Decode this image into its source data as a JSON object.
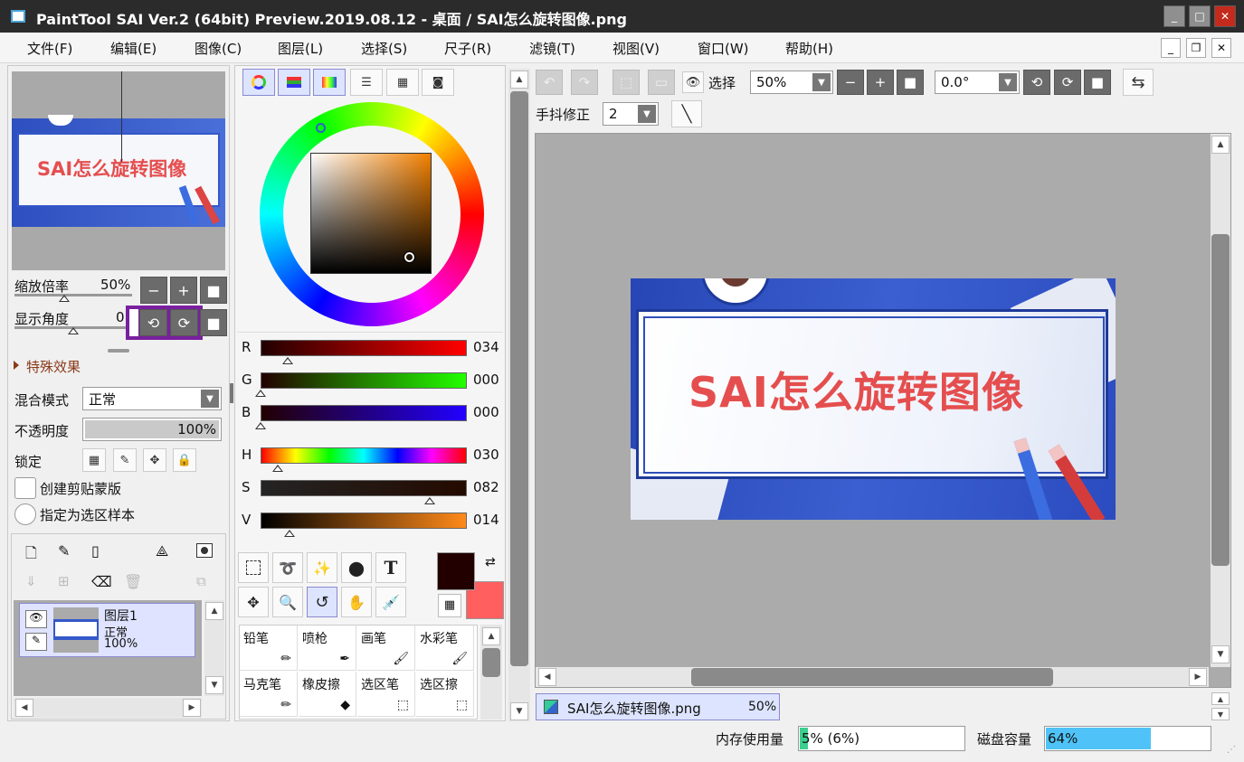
{
  "window": {
    "title": "PaintTool SAI Ver.2 (64bit) Preview.2019.08.12 - 桌面 / SAI怎么旋转图像.png",
    "minimize": "_",
    "maximize": "□",
    "close": "✕"
  },
  "menu": {
    "items": [
      "文件(F)",
      "编辑(E)",
      "图像(C)",
      "图层(L)",
      "选择(S)",
      "尺子(R)",
      "滤镜(T)",
      "视图(V)",
      "窗口(W)",
      "帮助(H)"
    ],
    "doc_min": "_",
    "doc_restore": "❐",
    "doc_close": "✕"
  },
  "navigator": {
    "banner_text": "SAI怎么旋转图像",
    "zoom_label": "缩放倍率",
    "zoom_value": "50%",
    "angle_label": "显示角度",
    "angle_value": "0",
    "zoom_level": 0.5
  },
  "layer_props": {
    "effects_label": "特殊效果",
    "blend_label": "混合模式",
    "blend_value": "正常",
    "opacity_label": "不透明度",
    "opacity_value": "100%",
    "opacity_fraction": 1.0,
    "lock_label": "锁定",
    "clip_label": "创建剪贴蒙版",
    "sample_label": "指定为选区样本"
  },
  "layers": [
    {
      "name": "图层1",
      "mode": "正常",
      "opacity": "100%"
    }
  ],
  "color": {
    "rgb": [
      {
        "label": "R",
        "value": "034",
        "fraction": 0.133
      },
      {
        "label": "G",
        "value": "000",
        "fraction": 0.0
      },
      {
        "label": "B",
        "value": "000",
        "fraction": 0.0
      }
    ],
    "hsv": [
      {
        "label": "H",
        "value": "030",
        "fraction": 0.083
      },
      {
        "label": "S",
        "value": "082",
        "fraction": 0.82
      },
      {
        "label": "V",
        "value": "014",
        "fraction": 0.14
      }
    ],
    "foreground": "#220000",
    "background": "#ff5f5f"
  },
  "tools": {
    "text_tool_label": "T"
  },
  "brushes": [
    "铅笔",
    "喷枪",
    "画笔",
    "水彩笔",
    "马克笔",
    "橡皮擦",
    "选区笔",
    "选区擦"
  ],
  "canvas_toolbar": {
    "select_label": "选择",
    "zoom_value": "50%",
    "angle_value": "0.0°",
    "stabilizer_label": "手抖修正",
    "stabilizer_value": "2"
  },
  "document_tab": {
    "name": "SAI怎么旋转图像.png",
    "zoom": "50%"
  },
  "status": {
    "memory_label": "内存使用量",
    "memory_value": "5% (6%)",
    "memory_fraction": 0.05,
    "disk_label": "磁盘容量",
    "disk_value": "64%",
    "disk_fraction": 0.64
  },
  "colors": {
    "accent": "#4d36ff",
    "highlight_box": "#7a1fa0",
    "banner_text": "#e54e4e",
    "banner_blue": "#3457c9"
  }
}
